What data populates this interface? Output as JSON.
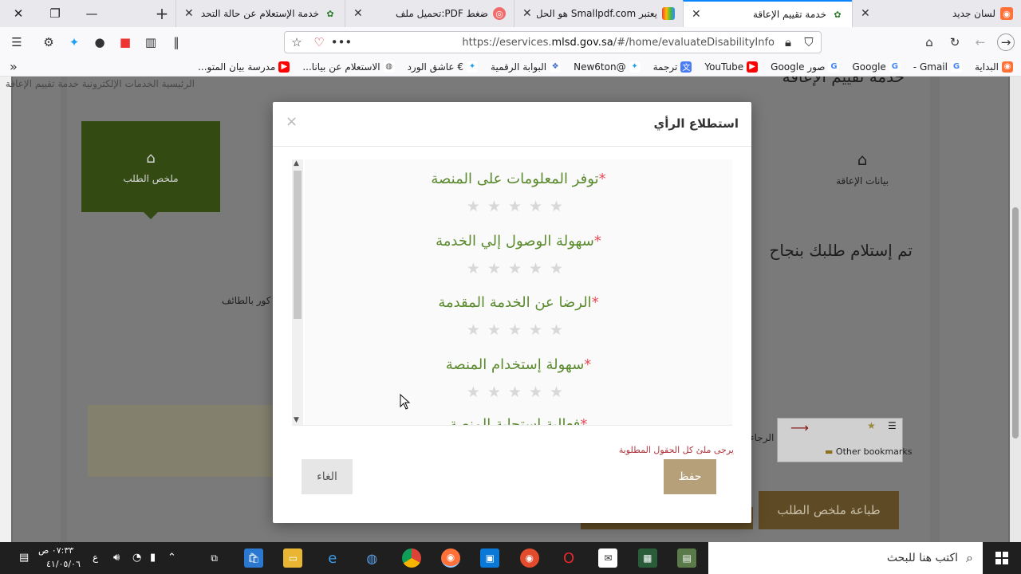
{
  "browser": {
    "tabs": [
      {
        "title": "لسان جديد",
        "active": false
      },
      {
        "title": "خدمة تقييم الإعاقة",
        "active": true
      },
      {
        "title": "يعتبر Smallpdf.com هو الحل",
        "active": false
      },
      {
        "title": "ضغط PDF:تحميل ملف",
        "active": false
      },
      {
        "title": "خدمة الإستعلام عن حالة التحد",
        "active": false
      }
    ],
    "url_prefix": "https://eservices.",
    "url_domain": "mlsd.gov.sa",
    "url_path": "/#/home/evaluateDisabilityInfo",
    "bookmarks": [
      {
        "label": "البداية",
        "icon": "firefox-icon",
        "color": "#ff7139"
      },
      {
        "label": "Gmail -",
        "icon": "google-icon",
        "color": "#4285f4"
      },
      {
        "label": "Google",
        "icon": "google-icon",
        "color": "#4285f4"
      },
      {
        "label": "صور Google",
        "icon": "google-icon",
        "color": "#4285f4"
      },
      {
        "label": "YouTube",
        "icon": "youtube-icon",
        "color": "#ff0000"
      },
      {
        "label": "ترجمة",
        "icon": "translate-icon",
        "color": "#4a7df5"
      },
      {
        "label": "@New6ton",
        "icon": "twitter-icon",
        "color": "#1da1f2"
      },
      {
        "label": "البوابة الرقمية",
        "icon": "portal-icon",
        "color": "#3a6cc4"
      },
      {
        "label": "€ عاشق الورد",
        "icon": "twitter-icon",
        "color": "#1da1f2"
      },
      {
        "label": "الاستعلام عن بيانا...",
        "icon": "globe-icon",
        "color": "#555555"
      },
      {
        "label": "مدرسة بيان المتو...",
        "icon": "youtube-icon",
        "color": "#ff0000"
      }
    ]
  },
  "background_page": {
    "heading": "خدمة تقييم الإعاقة",
    "breadcrumb": "الرئيسية   الخدمات الإلكترونية   خدمة تقييم الإعاقة",
    "step_disability": "بيانات الإعاقة",
    "step_summary": "ملخص الطلب",
    "success_text": "تم إستلام طلبك بنجاح",
    "taif_text": "كور بالطائف",
    "return_text": "الرجاء",
    "bookmarks_inset": "Other bookmarks",
    "print_button": "طباعة ملخص الطلب"
  },
  "modal": {
    "title": "استطلاع الرأي",
    "close_label": "×",
    "questions": [
      {
        "label": "توفر المعلومات على المنصة",
        "required": "*",
        "rating": 0
      },
      {
        "label": "سهولة الوصول إلي الخدمة",
        "required": "*",
        "rating": 0
      },
      {
        "label": "الرضا عن الخدمة المقدمة",
        "required": "*",
        "rating": 0
      },
      {
        "label": "سهولة إستخدام المنصة",
        "required": "*",
        "rating": 0
      }
    ],
    "partial_question": "فعالية إستجابة المنصة",
    "star_glyphs": "★★★★★",
    "validation_message": "يرجى ملئ كل الحقول المطلوبة",
    "save_label": "حفظ",
    "cancel_label": "الغاء"
  },
  "taskbar": {
    "search_placeholder": "اكتب هنا للبحث",
    "clock_time": "٠٧:٣٣ ص",
    "clock_date": "٤١/٠٥/٠٦",
    "language": "ع"
  }
}
